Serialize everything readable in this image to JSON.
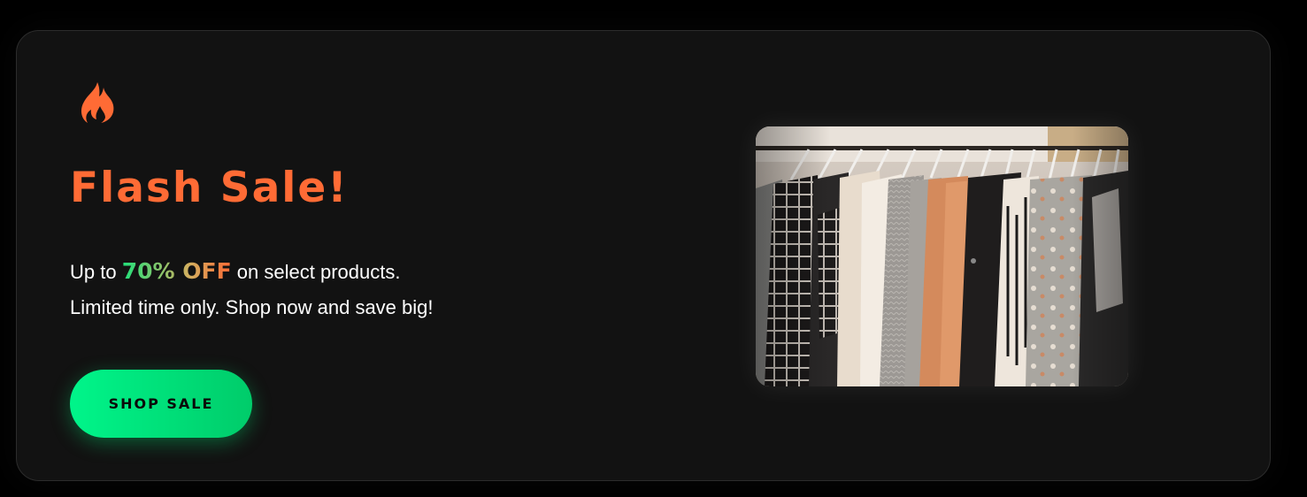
{
  "promo": {
    "icon": "flame-icon",
    "title": "Flash Sale!",
    "line1_prefix": "Up to",
    "highlight": "70% OFF",
    "line1_suffix": "on select products.",
    "line2": "Limited time only. Shop now and save big!",
    "button_label": "SHOP SALE",
    "image": "clothing-rack-photo"
  },
  "colors": {
    "background": "#000000",
    "card": "#121212",
    "accent": "#ff6b35",
    "button": "#00e676"
  }
}
